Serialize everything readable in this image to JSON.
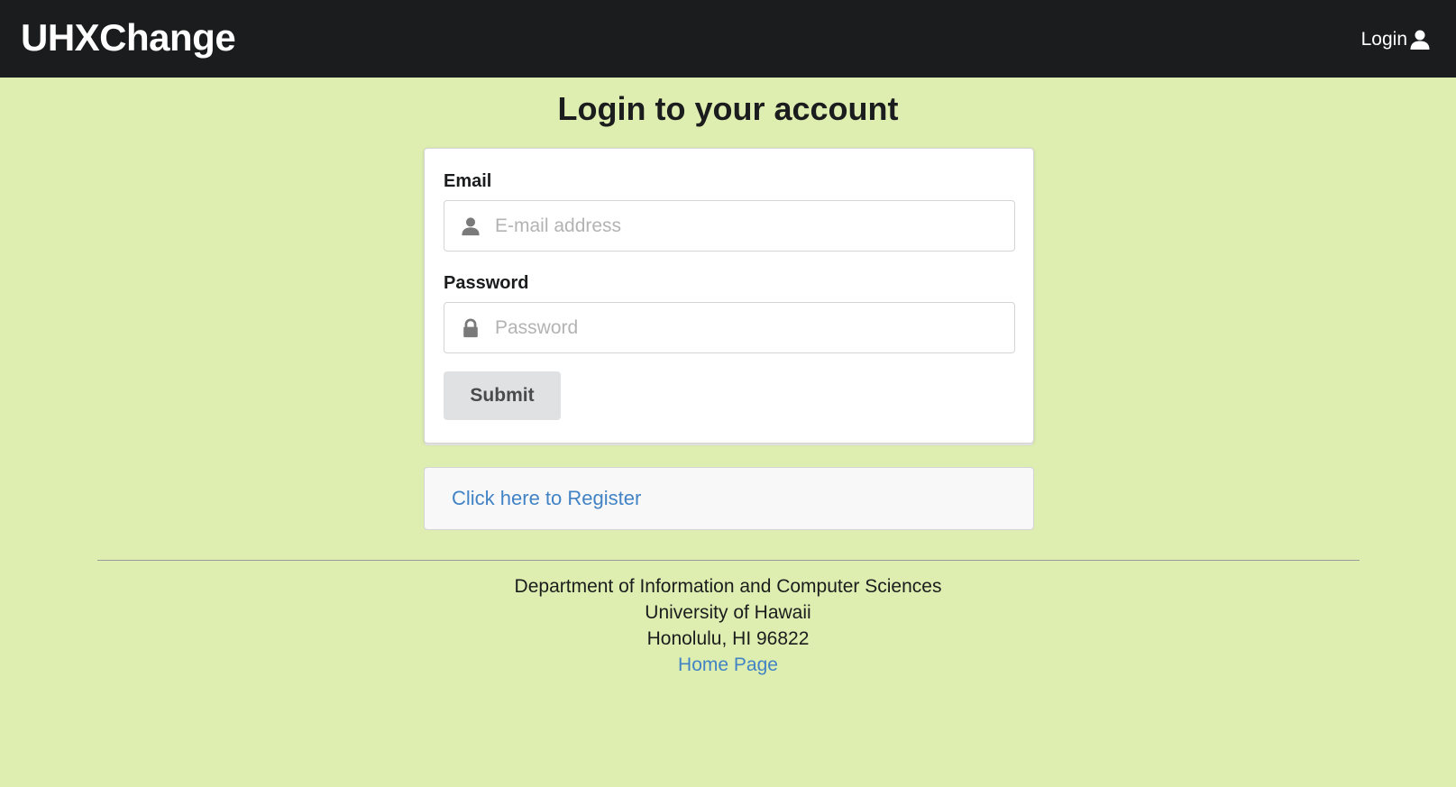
{
  "navbar": {
    "brand": "UHXChange",
    "login_label": "Login",
    "login_icon": "user-icon"
  },
  "page": {
    "title": "Login to your account"
  },
  "form": {
    "email_label": "Email",
    "email_placeholder": "E-mail address",
    "email_icon": "user-icon",
    "password_label": "Password",
    "password_placeholder": "Password",
    "password_icon": "lock-icon",
    "submit_label": "Submit"
  },
  "register": {
    "link_text": "Click here to Register"
  },
  "footer": {
    "line1": "Department of Information and Computer Sciences",
    "line2": "University of Hawaii",
    "line3": "Honolulu, HI 96822",
    "home_link": "Home Page"
  },
  "colors": {
    "page_background": "#ddeeb0",
    "navbar_background": "#1b1c1d",
    "link": "#4183c4",
    "button_background": "#e0e1e2"
  }
}
